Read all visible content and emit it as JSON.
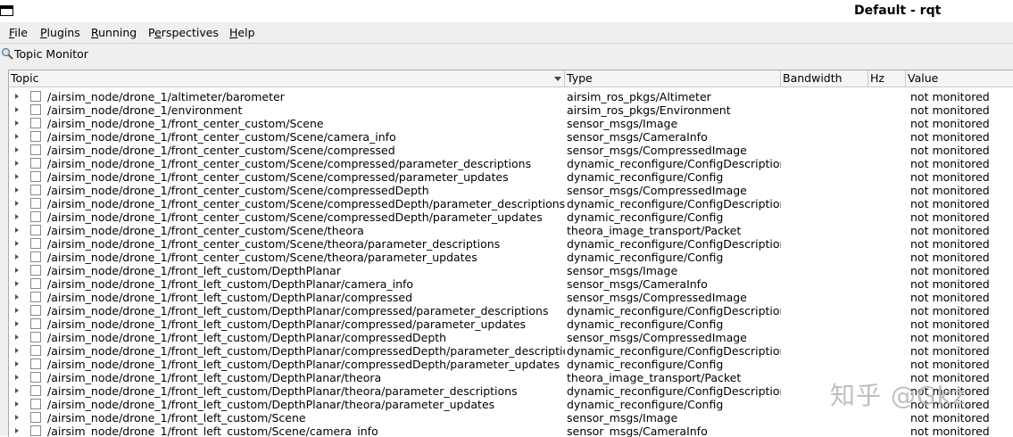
{
  "window": {
    "title": "Default - rqt"
  },
  "menubar": {
    "items": [
      {
        "mnemonic": "F",
        "rest": "ile"
      },
      {
        "mnemonic": "P",
        "rest": "lugins"
      },
      {
        "mnemonic": "R",
        "rest": "unning"
      },
      {
        "pre": "P",
        "mnemonic": "e",
        "rest": "rspectives"
      },
      {
        "mnemonic": "H",
        "rest": "elp"
      }
    ]
  },
  "plugin": {
    "title": "Topic Monitor",
    "icon": "magnifier-icon"
  },
  "table": {
    "columns": [
      "Topic",
      "Type",
      "Bandwidth",
      "Hz",
      "Value"
    ],
    "rows": [
      {
        "topic": "/airsim_node/drone_1/altimeter/barometer",
        "type": "airsim_ros_pkgs/Altimeter",
        "value": "not monitored"
      },
      {
        "topic": "/airsim_node/drone_1/environment",
        "type": "airsim_ros_pkgs/Environment",
        "value": "not monitored"
      },
      {
        "topic": "/airsim_node/drone_1/front_center_custom/Scene",
        "type": "sensor_msgs/Image",
        "value": "not monitored"
      },
      {
        "topic": "/airsim_node/drone_1/front_center_custom/Scene/camera_info",
        "type": "sensor_msgs/CameraInfo",
        "value": "not monitored"
      },
      {
        "topic": "/airsim_node/drone_1/front_center_custom/Scene/compressed",
        "type": "sensor_msgs/CompressedImage",
        "value": "not monitored"
      },
      {
        "topic": "/airsim_node/drone_1/front_center_custom/Scene/compressed/parameter_descriptions",
        "type": "dynamic_reconfigure/ConfigDescription",
        "value": "not monitored"
      },
      {
        "topic": "/airsim_node/drone_1/front_center_custom/Scene/compressed/parameter_updates",
        "type": "dynamic_reconfigure/Config",
        "value": "not monitored"
      },
      {
        "topic": "/airsim_node/drone_1/front_center_custom/Scene/compressedDepth",
        "type": "sensor_msgs/CompressedImage",
        "value": "not monitored"
      },
      {
        "topic": "/airsim_node/drone_1/front_center_custom/Scene/compressedDepth/parameter_descriptions",
        "type": "dynamic_reconfigure/ConfigDescription",
        "value": "not monitored"
      },
      {
        "topic": "/airsim_node/drone_1/front_center_custom/Scene/compressedDepth/parameter_updates",
        "type": "dynamic_reconfigure/Config",
        "value": "not monitored"
      },
      {
        "topic": "/airsim_node/drone_1/front_center_custom/Scene/theora",
        "type": "theora_image_transport/Packet",
        "value": "not monitored"
      },
      {
        "topic": "/airsim_node/drone_1/front_center_custom/Scene/theora/parameter_descriptions",
        "type": "dynamic_reconfigure/ConfigDescription",
        "value": "not monitored"
      },
      {
        "topic": "/airsim_node/drone_1/front_center_custom/Scene/theora/parameter_updates",
        "type": "dynamic_reconfigure/Config",
        "value": "not monitored"
      },
      {
        "topic": "/airsim_node/drone_1/front_left_custom/DepthPlanar",
        "type": "sensor_msgs/Image",
        "value": "not monitored"
      },
      {
        "topic": "/airsim_node/drone_1/front_left_custom/DepthPlanar/camera_info",
        "type": "sensor_msgs/CameraInfo",
        "value": "not monitored"
      },
      {
        "topic": "/airsim_node/drone_1/front_left_custom/DepthPlanar/compressed",
        "type": "sensor_msgs/CompressedImage",
        "value": "not monitored"
      },
      {
        "topic": "/airsim_node/drone_1/front_left_custom/DepthPlanar/compressed/parameter_descriptions",
        "type": "dynamic_reconfigure/ConfigDescription",
        "value": "not monitored"
      },
      {
        "topic": "/airsim_node/drone_1/front_left_custom/DepthPlanar/compressed/parameter_updates",
        "type": "dynamic_reconfigure/Config",
        "value": "not monitored"
      },
      {
        "topic": "/airsim_node/drone_1/front_left_custom/DepthPlanar/compressedDepth",
        "type": "sensor_msgs/CompressedImage",
        "value": "not monitored"
      },
      {
        "topic": "/airsim_node/drone_1/front_left_custom/DepthPlanar/compressedDepth/parameter_descriptions",
        "type": "dynamic_reconfigure/ConfigDescription",
        "value": "not monitored"
      },
      {
        "topic": "/airsim_node/drone_1/front_left_custom/DepthPlanar/compressedDepth/parameter_updates",
        "type": "dynamic_reconfigure/Config",
        "value": "not monitored"
      },
      {
        "topic": "/airsim_node/drone_1/front_left_custom/DepthPlanar/theora",
        "type": "theora_image_transport/Packet",
        "value": "not monitored"
      },
      {
        "topic": "/airsim_node/drone_1/front_left_custom/DepthPlanar/theora/parameter_descriptions",
        "type": "dynamic_reconfigure/ConfigDescription",
        "value": "not monitored"
      },
      {
        "topic": "/airsim_node/drone_1/front_left_custom/DepthPlanar/theora/parameter_updates",
        "type": "dynamic_reconfigure/Config",
        "value": "not monitored"
      },
      {
        "topic": "/airsim_node/drone_1/front_left_custom/Scene",
        "type": "sensor_msgs/Image",
        "value": "not monitored"
      },
      {
        "topic": "/airsim_node/drone_1/front_left_custom/Scene/camera_info",
        "type": "sensor_msgs/CameraInfo",
        "value": "not monitored"
      }
    ]
  },
  "watermark": "知乎 @Gkz"
}
